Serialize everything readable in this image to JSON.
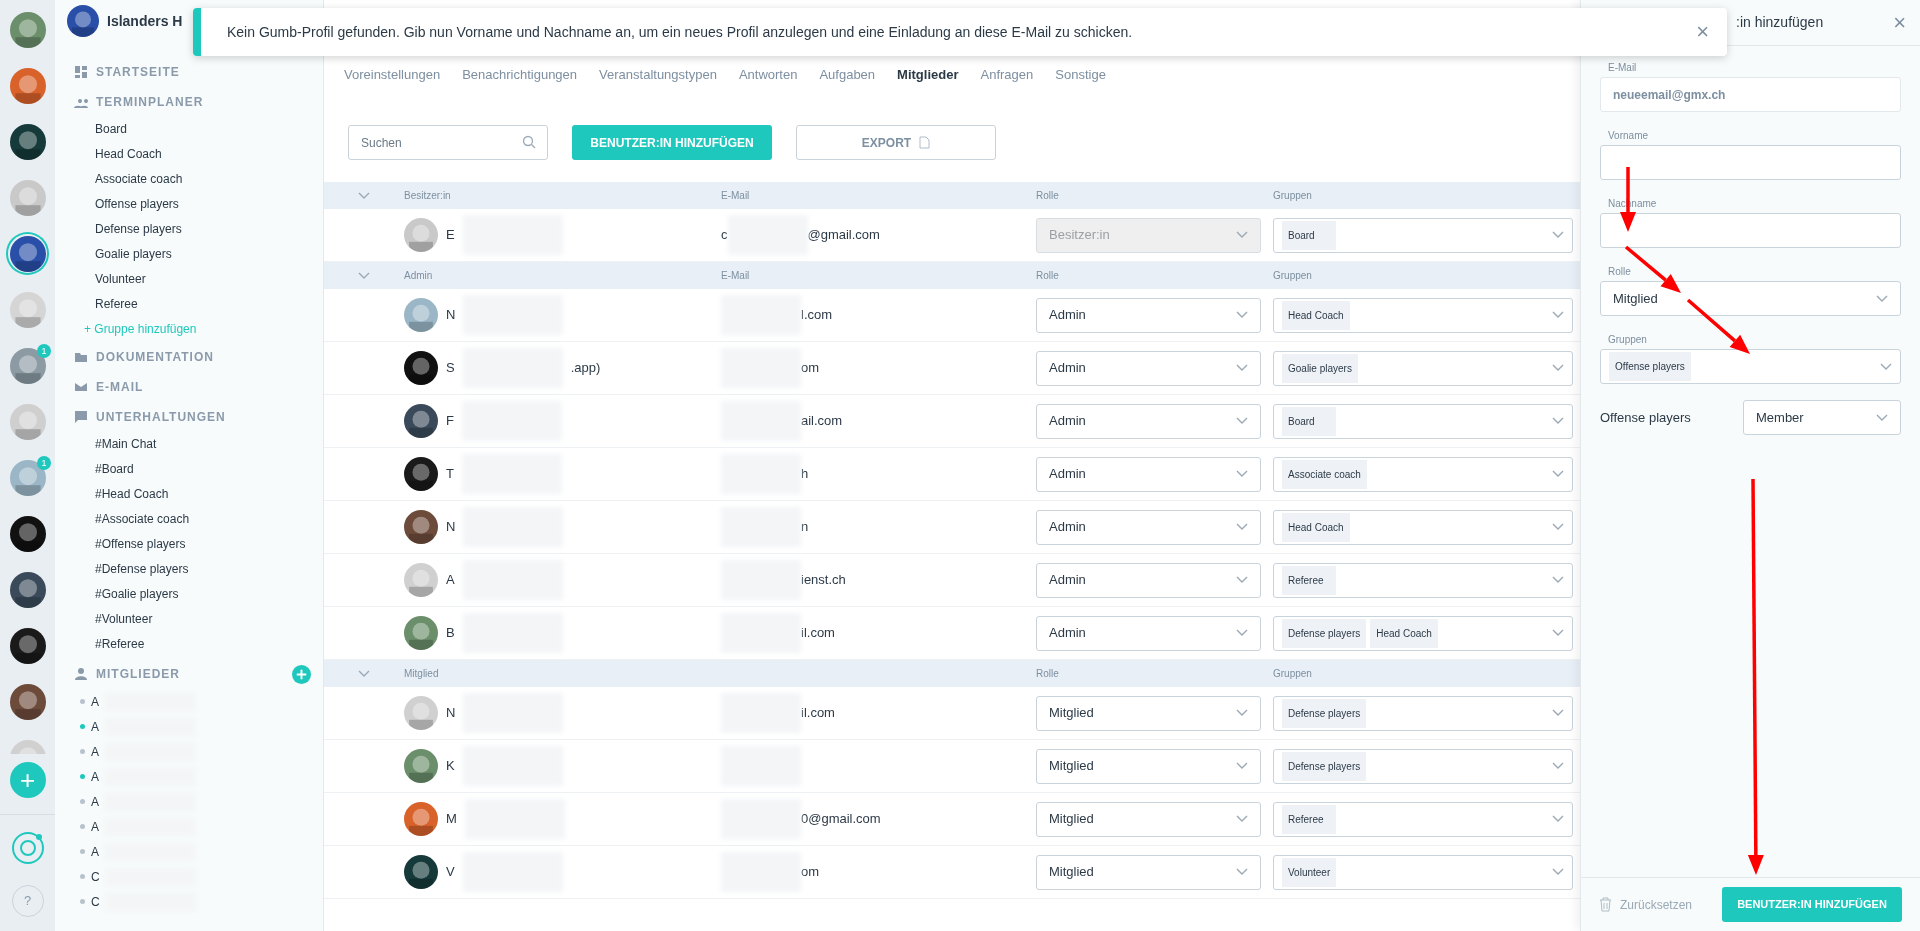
{
  "servers": [
    {
      "selected": false
    },
    {
      "selected": false
    },
    {
      "selected": false
    },
    {
      "selected": false
    },
    {
      "selected": true
    },
    {
      "selected": false
    },
    {
      "selected": false,
      "badge": "1"
    },
    {
      "selected": false
    },
    {
      "selected": false,
      "badge": "1"
    },
    {
      "selected": false
    },
    {
      "selected": false
    },
    {
      "selected": false
    },
    {
      "selected": false
    },
    {
      "selected": false
    }
  ],
  "rail_bottom": {
    "add": "+",
    "help": "?"
  },
  "sidebar": {
    "title": "Islanders H",
    "sections": [
      {
        "kind": "home",
        "label": "STARTSEITE"
      },
      {
        "kind": "calendar",
        "label": "TERMINPLANER",
        "items": [
          "Board",
          "Head Coach",
          "Associate coach",
          "Offense players",
          "Defense players",
          "Goalie players",
          "Volunteer",
          "Referee"
        ],
        "add_link": "+ Gruppe hinzufügen"
      },
      {
        "kind": "folder",
        "label": "DOKUMENTATION"
      },
      {
        "kind": "mail",
        "label": "E-MAIL"
      },
      {
        "kind": "chat",
        "label": "UNTERHALTUNGEN",
        "items": [
          "#Main Chat",
          "#Board",
          "#Head Coach",
          "#Associate coach",
          "#Offense players",
          "#Defense players",
          "#Goalie players",
          "#Volunteer",
          "#Referee"
        ]
      }
    ],
    "members_label": "MITGLIEDER",
    "members": [
      {
        "initial": "A",
        "online": false
      },
      {
        "initial": "A",
        "online": true
      },
      {
        "initial": "A",
        "online": false
      },
      {
        "initial": "A",
        "online": true
      },
      {
        "initial": "A",
        "online": false
      },
      {
        "initial": "A",
        "online": false
      },
      {
        "initial": "A",
        "online": false
      },
      {
        "initial": "C",
        "online": false
      },
      {
        "initial": "C",
        "online": false
      }
    ]
  },
  "toast": {
    "message": "Kein Gumb-Profil gefunden. Gib nun Vorname und Nachname an, um ein neues Profil anzulegen und eine Einladung an diese E-Mail zu schicken.",
    "close": "×"
  },
  "tabs": [
    {
      "label": "Voreinstellungen",
      "selected": false
    },
    {
      "label": "Benachrichtigungen",
      "selected": false
    },
    {
      "label": "Veranstaltungstypen",
      "selected": false
    },
    {
      "label": "Antworten",
      "selected": false
    },
    {
      "label": "Aufgaben",
      "selected": false
    },
    {
      "label": "Mitglieder",
      "selected": true
    },
    {
      "label": "Anfragen",
      "selected": false
    },
    {
      "label": "Sonstige",
      "selected": false
    }
  ],
  "toolbar": {
    "search_placeholder": "Suchen",
    "add_button": "BENUTZER:IN HINZUFÜGEN",
    "export_button": "EXPORT"
  },
  "table": {
    "groups": [
      {
        "label": "Besitzer:in",
        "email_header": "E-Mail",
        "role_header": "Rolle",
        "groups_header": "Gruppen",
        "rows": [
          {
            "name": "E",
            "email_start": "c",
            "email_end": "@gmail.com",
            "role": "Besitzer:in",
            "disabled": true,
            "groups": [
              "Board"
            ]
          }
        ]
      },
      {
        "label": "Admin",
        "email_header": "E-Mail",
        "role_header": "Rolle",
        "groups_header": "Gruppen",
        "rows": [
          {
            "name": "N",
            "email_start": "",
            "email_end": "l.com",
            "role": "Admin",
            "disabled": false,
            "groups": [
              "Head Coach"
            ]
          },
          {
            "name": "S",
            "name_end": ".app)",
            "email_start": "",
            "email_end": "om",
            "role": "Admin",
            "disabled": false,
            "groups": [
              "Goalie players"
            ]
          },
          {
            "name": "F",
            "email_start": "",
            "email_end": "ail.com",
            "role": "Admin",
            "disabled": false,
            "groups": [
              "Board"
            ]
          },
          {
            "name": "T",
            "email_start": "",
            "email_end": "h",
            "role": "Admin",
            "disabled": false,
            "groups": [
              "Associate coach"
            ]
          },
          {
            "name": "N",
            "email_start": "",
            "email_end": "n",
            "role": "Admin",
            "disabled": false,
            "groups": [
              "Head Coach"
            ]
          },
          {
            "name": "A",
            "email_start": "",
            "email_end": "ienst.ch",
            "role": "Admin",
            "disabled": false,
            "groups": [
              "Referee"
            ]
          },
          {
            "name": "B",
            "email_start": "",
            "email_end": "il.com",
            "role": "Admin",
            "disabled": false,
            "groups": [
              "Defense players",
              "Head Coach"
            ]
          }
        ]
      },
      {
        "label": "Mitglied",
        "role_header": "Rolle",
        "groups_header": "Gruppen",
        "rows": [
          {
            "name": "N",
            "email_start": "",
            "email_end": "il.com",
            "role": "Mitglied",
            "disabled": false,
            "groups": [
              "Defense players"
            ]
          },
          {
            "name": "K",
            "email_start": "",
            "email_end": "",
            "role": "Mitglied",
            "disabled": false,
            "groups": [
              "Defense players"
            ]
          },
          {
            "name": "M",
            "email_start": "",
            "email_end": "0@gmail.com",
            "role": "Mitglied",
            "disabled": false,
            "groups": [
              "Referee"
            ]
          },
          {
            "name": "V",
            "email_start": "",
            "email_end": "om",
            "role": "Mitglied",
            "disabled": false,
            "groups": [
              "Volunteer"
            ]
          }
        ]
      }
    ]
  },
  "panel": {
    "title": ":in hinzufügen",
    "close": "×",
    "email_label": "E-Mail",
    "email_value": "neueemail@gmx.ch",
    "first_label": "Vorname",
    "last_label": "Nachname",
    "role_label": "Rolle",
    "role_value": "Mitglied",
    "groups_label": "Gruppen",
    "groups": [
      "Offense players"
    ],
    "group_roles": [
      {
        "group": "Offense players",
        "role": "Member"
      }
    ],
    "reset": "Zurücksetzen",
    "submit": "BENUTZER:IN HINZUFÜGEN"
  }
}
